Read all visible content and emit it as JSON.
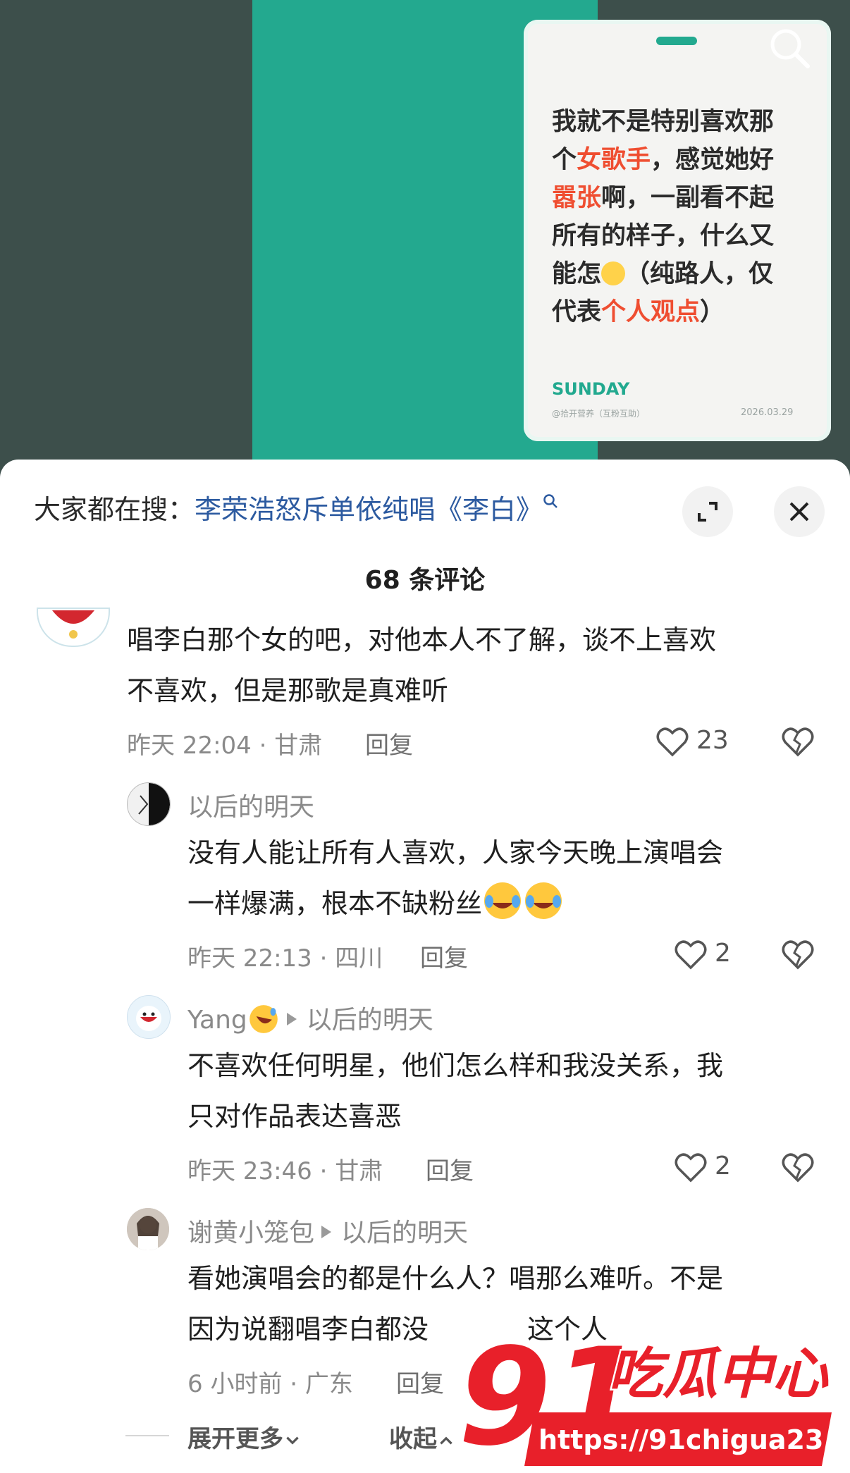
{
  "poster": {
    "line1": "我就不是特别喜欢那",
    "line2a": "个",
    "line2b": "女歌手",
    "line2c": "，感觉她好",
    "line3a": "嚣张",
    "line3b": "啊，一副看不起",
    "line4": "所有的样子，什么又",
    "line5a": "能怎",
    "line5b": "（纯路人，仅",
    "line6a": "代表",
    "line6b": "个人观点",
    "line6c": "）",
    "brand": "SUNDAY",
    "handle": "@拾开营养（互粉互助）",
    "date": "2026.03.29"
  },
  "suggestion": {
    "prefix": "大家都在搜：",
    "query": "李荣浩怒斥单依纯唱《李白》"
  },
  "comment_count": "68 条评论",
  "comments": [
    {
      "text_line1": "唱李白那个女的吧，对他本人不了解，谈不上喜欢",
      "text_line2": "不喜欢，但是那歌是真难听",
      "meta": "昨天 22:04 · 甘肃",
      "reply": "回复",
      "likes": "23"
    },
    {
      "user": "以后的明天",
      "text_line1": "没有人能让所有人喜欢，人家今天晚上演唱会",
      "text_line2": "一样爆满，根本不缺粉丝",
      "meta": "昨天 22:13 · 四川",
      "reply": "回复",
      "likes": "2"
    },
    {
      "user": "Yang",
      "reply_to": "以后的明天",
      "text_line1": "不喜欢任何明星，他们怎么样和我没关系，我",
      "text_line2": "只对作品表达喜恶",
      "meta": "昨天 23:46 · 甘肃",
      "reply": "回复",
      "likes": "2"
    },
    {
      "user": "谢黄小笼包",
      "reply_to": "以后的明天",
      "text_line1": "看她演唱会的都是什么人？唱那么难听。不是",
      "text_line2": "因为说翻唱李白都没",
      "text_line2_tail": "这个人",
      "meta": "6 小时前 · 广东",
      "reply": "回复"
    }
  ],
  "expand_more": "展开更多",
  "collapse": "收起",
  "watermark": {
    "big": "91",
    "text": "吃瓜中心",
    "url": "https://91chigua23.com"
  },
  "colors": {
    "accent_red": "#ef4e31",
    "poster_teal": "#23a98f",
    "link_blue": "#2c5aa0"
  }
}
